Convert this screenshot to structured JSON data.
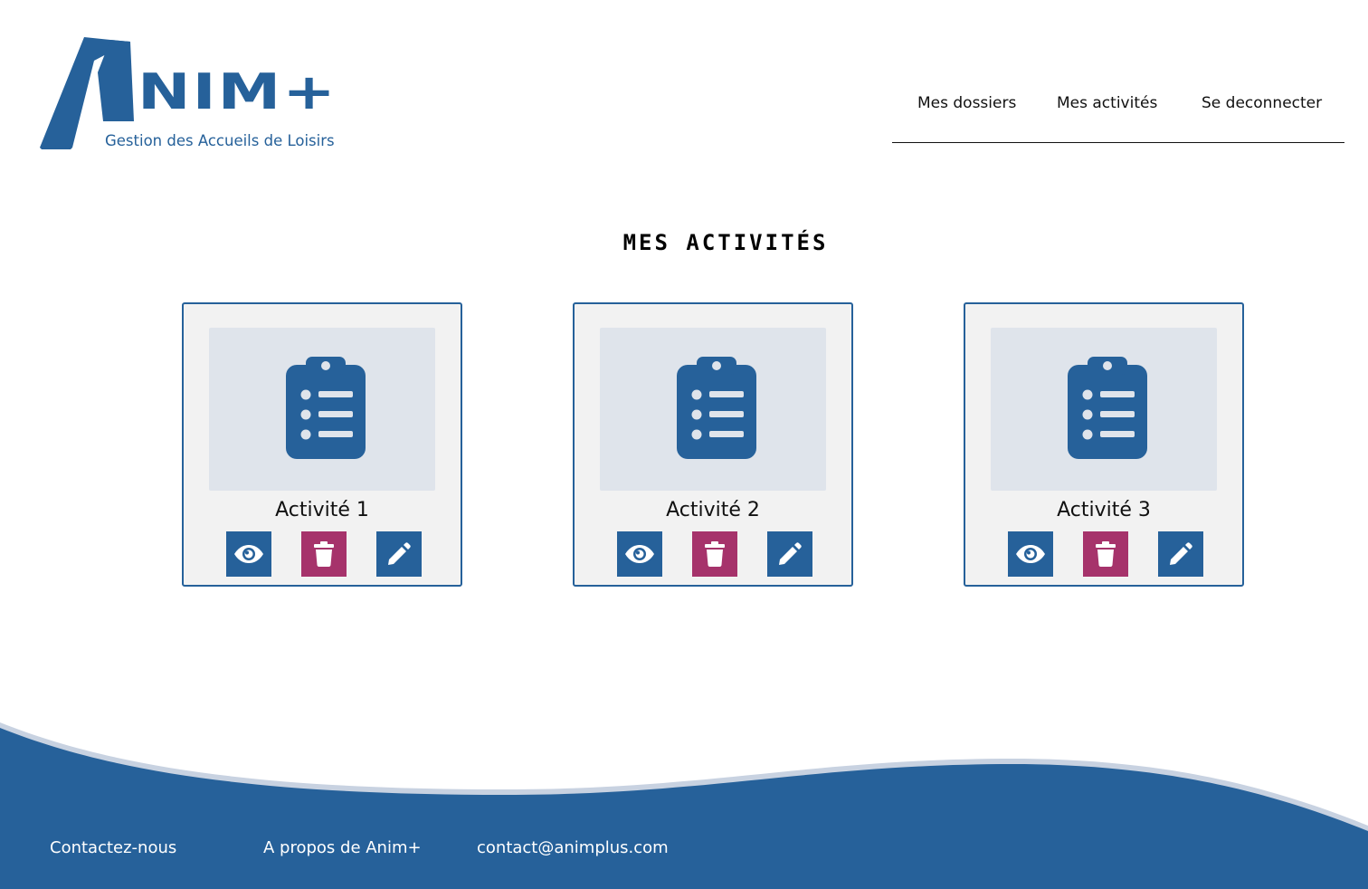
{
  "brand": {
    "name": "NIM+",
    "tagline": "Gestion des Accueils de Loisirs",
    "primary_color": "#26619a",
    "accent_color": "#a6336b"
  },
  "nav": {
    "items": [
      {
        "label": "Mes dossiers"
      },
      {
        "label": "Mes activités"
      },
      {
        "label": "Se deconnecter"
      }
    ]
  },
  "main": {
    "title": "Mes activités",
    "activities": [
      {
        "title": "Activité 1",
        "icon": "clipboard-list-icon"
      },
      {
        "title": "Activité 2",
        "icon": "clipboard-list-icon"
      },
      {
        "title": "Activité 3",
        "icon": "clipboard-list-icon"
      }
    ],
    "actions": {
      "view_icon": "eye-icon",
      "delete_icon": "trash-icon",
      "edit_icon": "pencil-icon"
    }
  },
  "footer": {
    "links": [
      {
        "label": "Contactez-nous"
      },
      {
        "label": "A propos de Anim+"
      },
      {
        "label": "contact@animplus.com"
      }
    ]
  }
}
